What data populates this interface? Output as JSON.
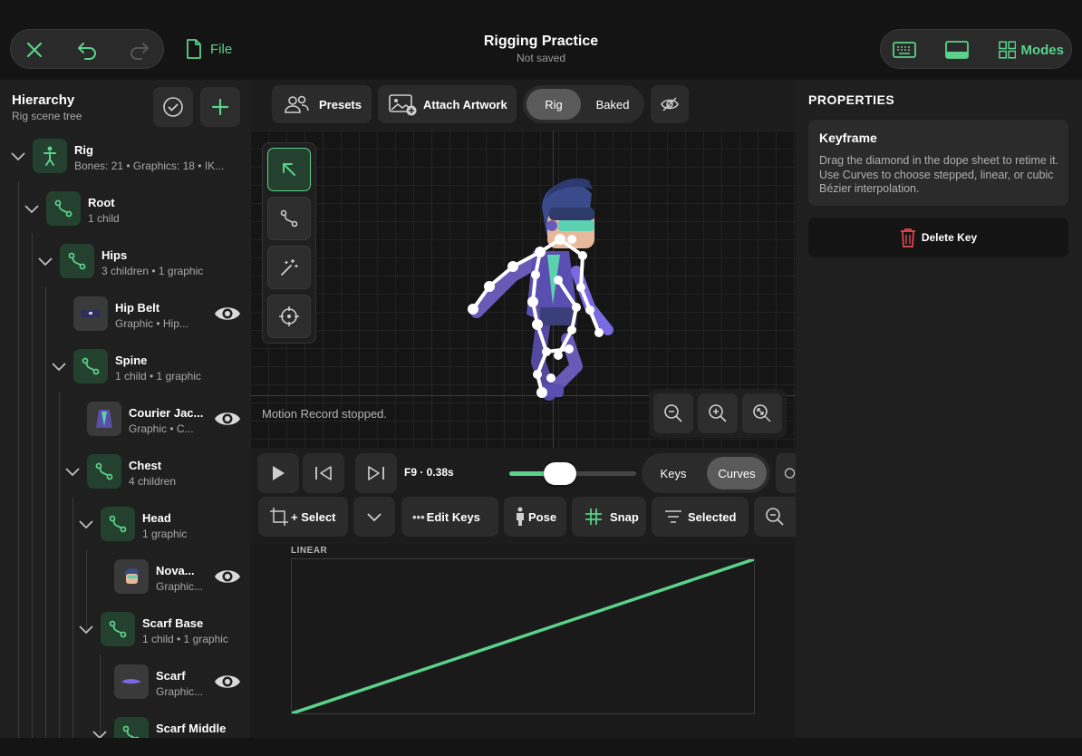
{
  "header": {
    "title": "Rigging Practice",
    "subtitle": "Not saved",
    "file_label": "File",
    "modes_label": "Modes"
  },
  "hierarchy": {
    "title": "Hierarchy",
    "subtitle": "Rig scene tree",
    "nodes": [
      {
        "name": "Rig",
        "sub": "Bones: 21 • Graphics: 18 • IK..."
      },
      {
        "name": "Root",
        "sub": "1 child"
      },
      {
        "name": "Hips",
        "sub": "3 children • 1 graphic"
      },
      {
        "name": "Hip Belt",
        "sub": "Graphic • Hip..."
      },
      {
        "name": "Spine",
        "sub": "1 child • 1 graphic"
      },
      {
        "name": "Courier Jac...",
        "sub": "Graphic • C..."
      },
      {
        "name": "Chest",
        "sub": "4 children"
      },
      {
        "name": "Head",
        "sub": "1 graphic"
      },
      {
        "name": "Nova...",
        "sub": "Graphic..."
      },
      {
        "name": "Scarf Base",
        "sub": "1 child • 1 graphic"
      },
      {
        "name": "Scarf",
        "sub": "Graphic..."
      },
      {
        "name": "Scarf Middle",
        "sub": ""
      }
    ]
  },
  "toolbar": {
    "presets": "Presets",
    "attach": "Attach Artwork",
    "rig": "Rig",
    "baked": "Baked"
  },
  "canvas": {
    "status": "Motion Record stopped."
  },
  "timeline": {
    "frame": "F9 · 0.38s",
    "scrub": 0.4,
    "keys": "Keys",
    "curves": "Curves",
    "select": "+ Select",
    "edit_keys": "Edit Keys",
    "pose": "Pose",
    "snap": "Snap",
    "selected": "Selected"
  },
  "graph": {
    "label": "LINEAR"
  },
  "properties": {
    "title": "PROPERTIES",
    "card_title": "Keyframe",
    "card_text": "Drag the diamond in the dope sheet to retime it. Use Curves to choose stepped, linear, or cubic Bézier interpolation.",
    "delete_label": "Delete Key"
  },
  "colors": {
    "accent": "#5cd18a",
    "delete": "#e5484d"
  }
}
